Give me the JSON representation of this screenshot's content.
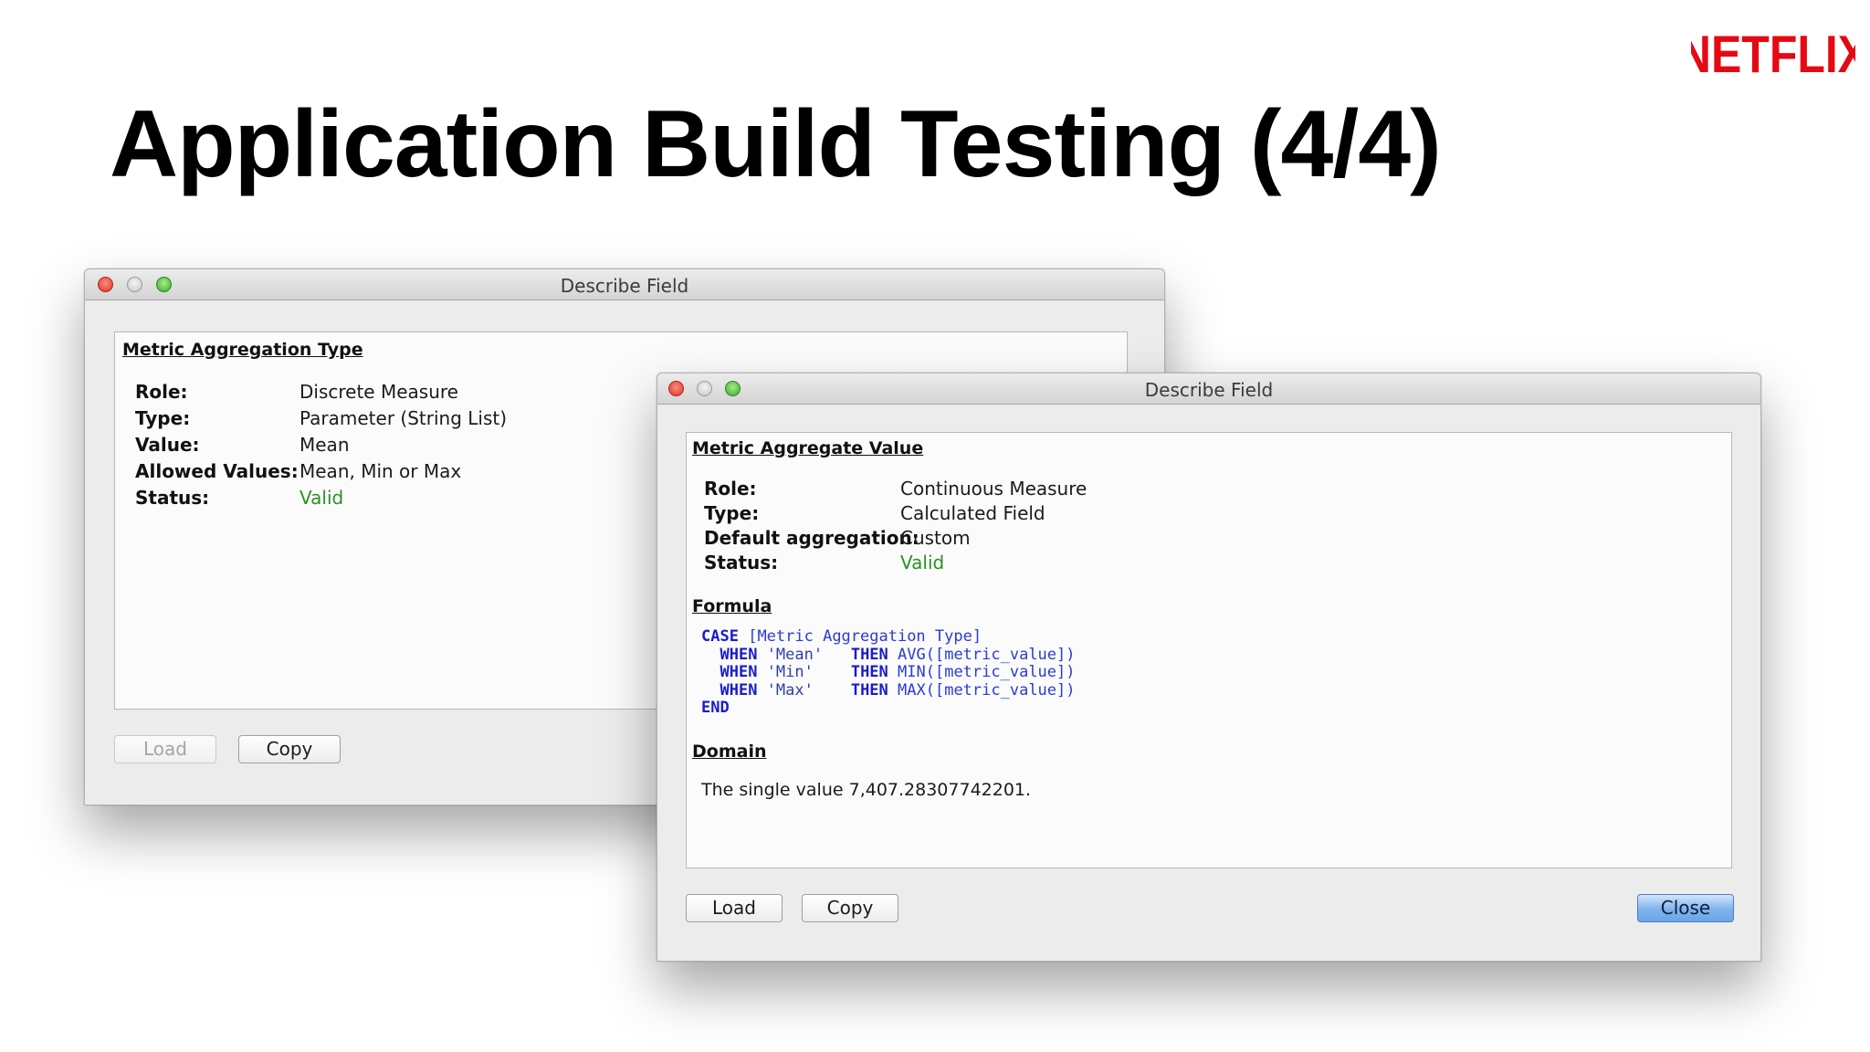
{
  "slide": {
    "title": "Application Build Testing (4/4)",
    "logo_text": "NETFLIX",
    "logo_color": "#e50914"
  },
  "window_back": {
    "title": "Describe Field",
    "section_title": "Metric Aggregation Type",
    "fields": [
      {
        "label": "Role:",
        "value": "Discrete Measure"
      },
      {
        "label": "Type:",
        "value": "Parameter (String List)"
      },
      {
        "label": "Value:",
        "value": "Mean"
      },
      {
        "label": "Allowed Values:",
        "value": "Mean, Min or Max"
      },
      {
        "label": "Status:",
        "value": "Valid"
      }
    ],
    "buttons": {
      "load": "Load",
      "copy": "Copy"
    }
  },
  "window_front": {
    "title": "Describe Field",
    "section_title": "Metric Aggregate Value",
    "fields": [
      {
        "label": "Role:",
        "value": "Continuous Measure"
      },
      {
        "label": "Type:",
        "value": "Calculated Field"
      },
      {
        "label": "Default aggregation:",
        "value": "Custom"
      },
      {
        "label": "Status:",
        "value": "Valid"
      }
    ],
    "formula_heading": "Formula",
    "formula": {
      "line1_kw": "CASE",
      "line1_field": "[Metric Aggregation Type]",
      "when": "WHEN",
      "then": "THEN",
      "end": "END",
      "branches": [
        {
          "str": "'Mean'",
          "func": "AVG([metric_value])"
        },
        {
          "str": "'Min'",
          "func": "MIN([metric_value])"
        },
        {
          "str": "'Max'",
          "func": "MAX([metric_value])"
        }
      ]
    },
    "domain_heading": "Domain",
    "domain_text": "The single value 7,407.28307742201.",
    "buttons": {
      "load": "Load",
      "copy": "Copy",
      "close": "Close"
    }
  },
  "colors": {
    "valid": "#2b9122",
    "formula_keyword": "#1a1acc",
    "default_button": "#6aa6ea"
  }
}
